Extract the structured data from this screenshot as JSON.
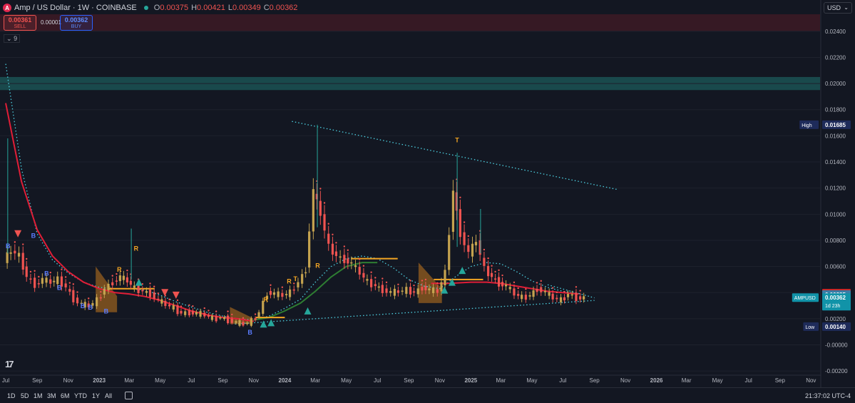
{
  "header": {
    "logo_letter": "A",
    "symbol": "Amp / US Dollar · 1W · COINBASE",
    "open_label": "O",
    "open": "0.00375",
    "high_label": "H",
    "high": "0.00421",
    "low_label": "L",
    "low": "0.00349",
    "close_label": "C",
    "close": "0.00362"
  },
  "trade": {
    "sell_price": "0.00361",
    "sell_label": "SELL",
    "spread": "0.00001",
    "buy_price": "0.00362",
    "buy_label": "BUY"
  },
  "indicator_label": "9",
  "currency": {
    "value": "USD",
    "icon": "chevron-down-icon"
  },
  "bottom": {
    "ranges": [
      "1D",
      "5D",
      "1M",
      "3M",
      "6M",
      "YTD",
      "1Y",
      "All"
    ],
    "calendar_icon": "calendar-icon",
    "clock": "21:37:02 UTC-4",
    "logo_icon": "tradingview-logo-icon"
  },
  "colors": {
    "background": "#131722",
    "up": "#26a69a",
    "down": "#ef5350",
    "up_candle": "#c5a34f",
    "cyan_line": "#4dd0e1",
    "red_line": "#e01e37",
    "green_line": "#2e7d32",
    "orange": "#f5a623"
  },
  "chart_data": {
    "type": "candlestick",
    "y_axis": {
      "ticks": [
        "0.02400",
        "0.02200",
        "0.02000",
        "0.01800",
        "0.01600",
        "0.01400",
        "0.01200",
        "0.01000",
        "0.00800",
        "0.00600",
        "0.00400",
        "0.00200",
        "-0.00000",
        "-0.00200"
      ],
      "tick_values": [
        0.024,
        0.022,
        0.02,
        0.018,
        0.016,
        0.014,
        0.012,
        0.01,
        0.008,
        0.006,
        0.004,
        0.002,
        0.0,
        -0.002
      ],
      "range": [
        -0.0021,
        0.0253
      ]
    },
    "x_axis": {
      "ticks": [
        "Jul",
        "Sep",
        "Nov",
        "2023",
        "Mar",
        "May",
        "Jul",
        "Sep",
        "Nov",
        "2024",
        "Mar",
        "May",
        "Jul",
        "Sep",
        "Nov",
        "2025",
        "Mar",
        "May",
        "Jul",
        "Sep",
        "Nov",
        "2026",
        "Mar",
        "May",
        "Jul",
        "Sep",
        "Nov"
      ],
      "start": "2022-07-01",
      "end": "2026-11-30"
    },
    "price_labels": [
      {
        "label": "High",
        "value": "0.01685"
      },
      {
        "label": "Low",
        "value": "0.00140"
      },
      {
        "label": "",
        "value": "0.00396"
      },
      {
        "label": "",
        "value": "0.00385"
      },
      {
        "label": "AMPUSD",
        "value": "0.00362",
        "sub": "1d 23h"
      }
    ],
    "zones": [
      {
        "from": 0.024,
        "to": 0.0253,
        "color": "rgba(120,28,40,0.35)"
      },
      {
        "from": 0.0195,
        "to": 0.0205,
        "color": "rgba(38,166,154,0.35)"
      }
    ],
    "candle_points": [
      [
        "2022-07-01",
        0.0065
      ],
      [
        "2022-07-15",
        0.0072
      ],
      [
        "2022-08-01",
        0.0068
      ],
      [
        "2022-08-15",
        0.0052
      ],
      [
        "2022-09-01",
        0.0046
      ],
      [
        "2022-09-15",
        0.005
      ],
      [
        "2022-10-01",
        0.0048
      ],
      [
        "2022-10-15",
        0.005
      ],
      [
        "2022-11-01",
        0.0044
      ],
      [
        "2022-11-15",
        0.0035
      ],
      [
        "2022-12-01",
        0.0031
      ],
      [
        "2022-12-15",
        0.003
      ],
      [
        "2023-01-01",
        0.0034
      ],
      [
        "2023-01-15",
        0.0043
      ],
      [
        "2023-02-01",
        0.0048
      ],
      [
        "2023-02-15",
        0.0052
      ],
      [
        "2023-03-01",
        0.0049
      ],
      [
        "2023-03-15",
        0.0043
      ],
      [
        "2023-04-01",
        0.0041
      ],
      [
        "2023-04-15",
        0.0039
      ],
      [
        "2023-05-01",
        0.0034
      ],
      [
        "2023-05-15",
        0.0031
      ],
      [
        "2023-06-01",
        0.0028
      ],
      [
        "2023-06-15",
        0.0024
      ],
      [
        "2023-07-01",
        0.0025
      ],
      [
        "2023-07-15",
        0.0024
      ],
      [
        "2023-08-01",
        0.0023
      ],
      [
        "2023-08-15",
        0.002
      ],
      [
        "2023-09-01",
        0.0021
      ],
      [
        "2023-09-15",
        0.0019
      ],
      [
        "2023-10-01",
        0.0017
      ],
      [
        "2023-10-15",
        0.0016
      ],
      [
        "2023-11-01",
        0.0018
      ],
      [
        "2023-11-15",
        0.0025
      ],
      [
        "2023-12-01",
        0.004
      ],
      [
        "2023-12-15",
        0.0039
      ],
      [
        "2024-01-01",
        0.0038
      ],
      [
        "2024-01-15",
        0.004
      ],
      [
        "2024-02-01",
        0.0048
      ],
      [
        "2024-02-15",
        0.0058
      ],
      [
        "2024-03-01",
        0.0118
      ],
      [
        "2024-03-15",
        0.01
      ],
      [
        "2024-04-01",
        0.0075
      ],
      [
        "2024-04-15",
        0.0068
      ],
      [
        "2024-05-01",
        0.0065
      ],
      [
        "2024-05-15",
        0.0062
      ],
      [
        "2024-06-01",
        0.0055
      ],
      [
        "2024-06-15",
        0.0048
      ],
      [
        "2024-07-01",
        0.0045
      ],
      [
        "2024-07-15",
        0.0042
      ],
      [
        "2024-08-01",
        0.004
      ],
      [
        "2024-08-15",
        0.0041
      ],
      [
        "2024-09-01",
        0.0042
      ],
      [
        "2024-09-15",
        0.004
      ],
      [
        "2024-10-01",
        0.0044
      ],
      [
        "2024-10-15",
        0.0042
      ],
      [
        "2024-11-01",
        0.0041
      ],
      [
        "2024-11-15",
        0.0055
      ],
      [
        "2024-12-01",
        0.0118
      ],
      [
        "2024-12-15",
        0.0085
      ],
      [
        "2025-01-01",
        0.007
      ],
      [
        "2025-01-15",
        0.008
      ],
      [
        "2025-02-01",
        0.0058
      ],
      [
        "2025-02-15",
        0.0052
      ],
      [
        "2025-03-01",
        0.0047
      ],
      [
        "2025-03-15",
        0.0045
      ],
      [
        "2025-04-01",
        0.0039
      ],
      [
        "2025-04-15",
        0.0036
      ],
      [
        "2025-05-01",
        0.0038
      ],
      [
        "2025-05-15",
        0.0043
      ],
      [
        "2025-06-01",
        0.004
      ],
      [
        "2025-06-15",
        0.0036
      ],
      [
        "2025-07-01",
        0.0034
      ],
      [
        "2025-07-15",
        0.0039
      ],
      [
        "2025-08-01",
        0.0036
      ]
    ],
    "series": [
      {
        "name": "",
        "style": "dotted",
        "color": "#4dd0e1",
        "points": [
          [
            "2022-07-01",
            0.0215
          ],
          [
            "2022-08-01",
            0.0135
          ],
          [
            "2022-09-01",
            0.0085
          ],
          [
            "2022-10-01",
            0.0065
          ],
          [
            "2022-11-01",
            0.0055
          ],
          [
            "2022-12-01",
            0.0048
          ],
          [
            "2023-01-01",
            0.0044
          ],
          [
            "2023-02-01",
            0.0043
          ],
          [
            "2023-03-01",
            0.0043
          ],
          [
            "2023-04-01",
            0.0042
          ],
          [
            "2023-05-01",
            0.0038
          ],
          [
            "2023-06-01",
            0.0033
          ],
          [
            "2023-07-01",
            0.0029
          ],
          [
            "2023-08-01",
            0.0025
          ],
          [
            "2023-09-01",
            0.0022
          ],
          [
            "2023-10-01",
            0.002
          ],
          [
            "2023-11-01",
            0.0019
          ],
          [
            "2023-12-01",
            0.0022
          ],
          [
            "2024-01-01",
            0.0028
          ],
          [
            "2024-02-01",
            0.0035
          ],
          [
            "2024-03-01",
            0.0048
          ],
          [
            "2024-04-01",
            0.006
          ],
          [
            "2024-05-01",
            0.0066
          ],
          [
            "2024-06-01",
            0.0068
          ],
          [
            "2024-07-01",
            0.0066
          ],
          [
            "2024-08-01",
            0.0059
          ],
          [
            "2024-09-01",
            0.005
          ],
          [
            "2024-10-01",
            0.0045
          ],
          [
            "2024-11-01",
            0.0043
          ],
          [
            "2024-12-01",
            0.0052
          ],
          [
            "2025-01-01",
            0.006
          ],
          [
            "2025-02-01",
            0.0063
          ],
          [
            "2025-03-01",
            0.0062
          ],
          [
            "2025-04-01",
            0.0056
          ],
          [
            "2025-05-01",
            0.0049
          ],
          [
            "2025-06-01",
            0.0044
          ],
          [
            "2025-07-01",
            0.0041
          ],
          [
            "2025-08-01",
            0.0039
          ]
        ]
      },
      {
        "name": "",
        "style": "solid",
        "color": "#e01e37",
        "points": [
          [
            "2022-07-01",
            0.0185
          ],
          [
            "2022-08-01",
            0.0125
          ],
          [
            "2022-09-01",
            0.0088
          ],
          [
            "2022-10-01",
            0.0068
          ],
          [
            "2022-11-01",
            0.0056
          ],
          [
            "2022-12-01",
            0.0048
          ],
          [
            "2023-01-01",
            0.0043
          ],
          [
            "2023-02-01",
            0.004
          ],
          [
            "2023-03-01",
            0.0039
          ],
          [
            "2023-04-01",
            0.0037
          ],
          [
            "2023-05-01",
            0.0034
          ],
          [
            "2023-06-01",
            0.003
          ],
          [
            "2023-07-01",
            0.0026
          ],
          [
            "2023-08-01",
            0.0023
          ],
          [
            "2023-09-01",
            0.0021
          ],
          [
            "2023-10-01",
            0.002
          ],
          [
            "2023-11-01",
            0.0018
          ]
        ]
      },
      {
        "name": "",
        "style": "solid",
        "color": "#e01e37",
        "points": [
          [
            "2024-10-15",
            0.0047
          ],
          [
            "2024-11-15",
            0.0047
          ],
          [
            "2025-01-01",
            0.0048
          ],
          [
            "2025-02-01",
            0.0048
          ],
          [
            "2025-03-01",
            0.0047
          ],
          [
            "2025-04-01",
            0.0045
          ],
          [
            "2025-05-01",
            0.0043
          ],
          [
            "2025-06-01",
            0.0041
          ],
          [
            "2025-07-01",
            0.004
          ],
          [
            "2025-08-01",
            0.0039
          ]
        ]
      },
      {
        "name": "",
        "style": "solid",
        "color": "#2e7d32",
        "points": [
          [
            "2023-11-01",
            0.0019
          ],
          [
            "2023-12-01",
            0.0021
          ],
          [
            "2024-01-01",
            0.0026
          ],
          [
            "2024-02-01",
            0.0032
          ],
          [
            "2024-03-01",
            0.0041
          ],
          [
            "2024-04-01",
            0.0052
          ],
          [
            "2024-05-01",
            0.006
          ],
          [
            "2024-06-01",
            0.0063
          ],
          [
            "2024-07-01",
            0.0063
          ]
        ]
      },
      {
        "name": "",
        "style": "solid",
        "color": "#f5a623",
        "points": [
          [
            "2023-01-20",
            0.0043
          ],
          [
            "2023-04-20",
            0.0043
          ]
        ]
      },
      {
        "name": "",
        "style": "solid",
        "color": "#f5a623",
        "points": [
          [
            "2023-11-05",
            0.0021
          ],
          [
            "2024-01-01",
            0.0021
          ]
        ]
      },
      {
        "name": "",
        "style": "solid",
        "color": "#f5a623",
        "points": [
          [
            "2024-05-10",
            0.0066
          ],
          [
            "2024-08-10",
            0.0066
          ]
        ]
      },
      {
        "name": "",
        "style": "solid",
        "color": "#f5a623",
        "points": [
          [
            "2024-10-20",
            0.005
          ],
          [
            "2025-01-25",
            0.005
          ]
        ]
      },
      {
        "name": "",
        "style": "dotted",
        "color": "#4dd0e1",
        "points": [
          [
            "2024-01-15",
            0.0171
          ],
          [
            "2025-10-15",
            0.0119
          ]
        ]
      },
      {
        "name": "",
        "style": "dotted",
        "color": "#4dd0e1",
        "points": [
          [
            "2023-09-25",
            0.0016
          ],
          [
            "2025-09-01",
            0.0034
          ]
        ]
      },
      {
        "name": "",
        "style": "dotted",
        "color": "#4dd0e1",
        "points": [
          [
            "2025-06-01",
            0.0046
          ],
          [
            "2025-09-01",
            0.0036
          ]
        ]
      }
    ],
    "bands": [
      {
        "from": "2022-12-25",
        "to": "2023-02-05",
        "low": 0.0025,
        "high": 0.006
      },
      {
        "from": "2023-09-15",
        "to": "2023-10-30",
        "low": 0.0016,
        "high": 0.0029
      },
      {
        "from": "2024-09-20",
        "to": "2024-11-05",
        "low": 0.0032,
        "high": 0.0063
      }
    ],
    "annotations": [
      {
        "text": "B",
        "date": "2022-07-01",
        "value": 0.0074,
        "color": "#5b7cff"
      },
      {
        "text": "B",
        "date": "2022-08-20",
        "value": 0.0082,
        "color": "#5b7cff"
      },
      {
        "text": "B",
        "date": "2022-09-15",
        "value": 0.0053,
        "color": "#5b7cff"
      },
      {
        "text": "B",
        "date": "2022-10-10",
        "value": 0.0042,
        "color": "#5b7cff"
      },
      {
        "text": "B",
        "date": "2022-11-25",
        "value": 0.0028,
        "color": "#5b7cff"
      },
      {
        "text": "B",
        "date": "2022-12-10",
        "value": 0.0027,
        "color": "#5b7cff"
      },
      {
        "text": "B",
        "date": "2023-01-10",
        "value": 0.0024,
        "color": "#5b7cff"
      },
      {
        "text": "B",
        "date": "2023-10-20",
        "value": 0.0008,
        "color": "#5b7cff"
      },
      {
        "text": "R",
        "date": "2023-02-05",
        "value": 0.0056,
        "color": "#f5a623"
      },
      {
        "text": "R",
        "date": "2023-03-10",
        "value": 0.0072,
        "color": "#f5a623"
      },
      {
        "text": "R",
        "date": "2023-11-20",
        "value": 0.0033,
        "color": "#f5a623"
      },
      {
        "text": "R",
        "date": "2024-01-05",
        "value": 0.0047,
        "color": "#f5a623"
      },
      {
        "text": "T",
        "date": "2024-01-18",
        "value": 0.0049,
        "color": "#f5a623"
      },
      {
        "text": "R",
        "date": "2024-03-01",
        "value": 0.0059,
        "color": "#f5a623"
      },
      {
        "text": "T",
        "date": "2024-12-01",
        "value": 0.0155,
        "color": "#f5a623"
      }
    ],
    "markers": [
      {
        "shape": "triangle-down",
        "date": "2022-07-25",
        "value": 0.0085,
        "color": "#ef5350"
      },
      {
        "shape": "triangle-down",
        "date": "2023-05-10",
        "value": 0.004,
        "color": "#ef5350"
      },
      {
        "shape": "triangle-down",
        "date": "2023-06-01",
        "value": 0.0038,
        "color": "#ef5350"
      },
      {
        "shape": "triangle-up",
        "date": "2023-11-20",
        "value": 0.0016,
        "color": "#26a69a"
      },
      {
        "shape": "triangle-up",
        "date": "2023-12-05",
        "value": 0.0017,
        "color": "#26a69a"
      },
      {
        "shape": "triangle-up",
        "date": "2024-02-15",
        "value": 0.0026,
        "color": "#26a69a"
      },
      {
        "shape": "triangle-up",
        "date": "2024-11-10",
        "value": 0.0042,
        "color": "#26a69a"
      },
      {
        "shape": "triangle-up",
        "date": "2024-11-25",
        "value": 0.0048,
        "color": "#26a69a"
      },
      {
        "shape": "triangle-up",
        "date": "2024-12-15",
        "value": 0.0057,
        "color": "#26a69a"
      },
      {
        "shape": "triangle-up",
        "date": "2023-03-20",
        "value": 0.0048,
        "color": "#26a69a"
      }
    ]
  }
}
